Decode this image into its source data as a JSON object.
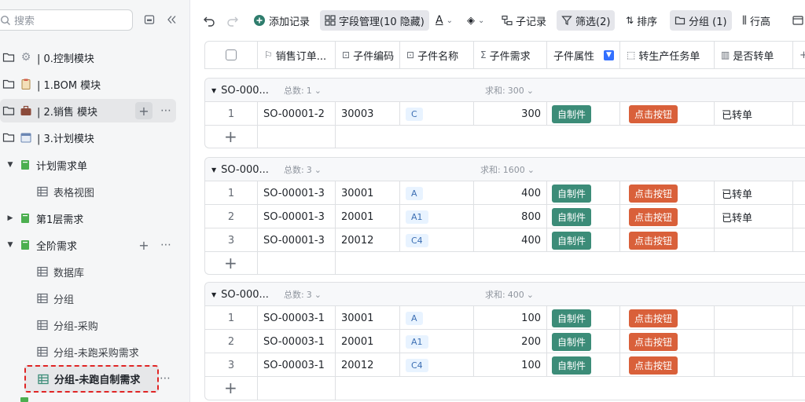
{
  "sidebar": {
    "search_placeholder": "搜索",
    "items": [
      {
        "label": "| 0.控制模块"
      },
      {
        "label": "| 1.BOM 模块"
      },
      {
        "label": "| 2.销售 模块"
      },
      {
        "label": "| 3.计划模块"
      },
      {
        "label": "计划需求单"
      },
      {
        "label": "表格视图"
      },
      {
        "label": "第1层需求"
      },
      {
        "label": "全阶需求"
      },
      {
        "label": "数据库"
      },
      {
        "label": "分组"
      },
      {
        "label": "分组-采购"
      },
      {
        "label": "分组-未跑采购需求"
      },
      {
        "label": "分组-未跑自制需求"
      }
    ]
  },
  "toolbar": {
    "add_record": "添加记录",
    "field_manage": "字段管理(10 隐藏)",
    "sub_record": "子记录",
    "filter": "筛选(2)",
    "sort": "排序",
    "group": "分组 (1)",
    "row_height": "行高"
  },
  "columns": [
    "销售订单...",
    "子件编码",
    "子件名称",
    "子件需求",
    "子件属性",
    "转生产任务单",
    "是否转单"
  ],
  "groups": [
    {
      "name": "SO-000...",
      "count_label": "总数:",
      "count": "1",
      "sum_label": "求和:",
      "sum": "300",
      "rows": [
        {
          "idx": "1",
          "order": "SO-00001-2",
          "code": "30003",
          "name": "C",
          "demand": "300",
          "attr": "自制件",
          "btn": "点击按钮",
          "converted": "已转单"
        }
      ]
    },
    {
      "name": "SO-000...",
      "count_label": "总数:",
      "count": "3",
      "sum_label": "求和:",
      "sum": "1600",
      "rows": [
        {
          "idx": "1",
          "order": "SO-00001-3",
          "code": "30001",
          "name": "A",
          "demand": "400",
          "attr": "自制件",
          "btn": "点击按钮",
          "converted": "已转单"
        },
        {
          "idx": "2",
          "order": "SO-00001-3",
          "code": "20001",
          "name": "A1",
          "demand": "800",
          "attr": "自制件",
          "btn": "点击按钮",
          "converted": "已转单"
        },
        {
          "idx": "3",
          "order": "SO-00001-3",
          "code": "20012",
          "name": "C4",
          "demand": "400",
          "attr": "自制件",
          "btn": "点击按钮",
          "converted": ""
        }
      ]
    },
    {
      "name": "SO-000...",
      "count_label": "总数:",
      "count": "3",
      "sum_label": "求和:",
      "sum": "400",
      "rows": [
        {
          "idx": "1",
          "order": "SO-00003-1",
          "code": "30001",
          "name": "A",
          "demand": "100",
          "attr": "自制件",
          "btn": "点击按钮",
          "converted": ""
        },
        {
          "idx": "2",
          "order": "SO-00003-1",
          "code": "20001",
          "name": "A1",
          "demand": "200",
          "attr": "自制件",
          "btn": "点击按钮",
          "converted": ""
        },
        {
          "idx": "3",
          "order": "SO-00003-1",
          "code": "20012",
          "name": "C4",
          "demand": "100",
          "attr": "自制件",
          "btn": "点击按钮",
          "converted": ""
        }
      ]
    }
  ],
  "colors": {
    "green_tag": "#3c8c78",
    "orange_button": "#d9603a",
    "letter_tag_bg": "#e8f3ff",
    "selection_border": "#e02525"
  }
}
